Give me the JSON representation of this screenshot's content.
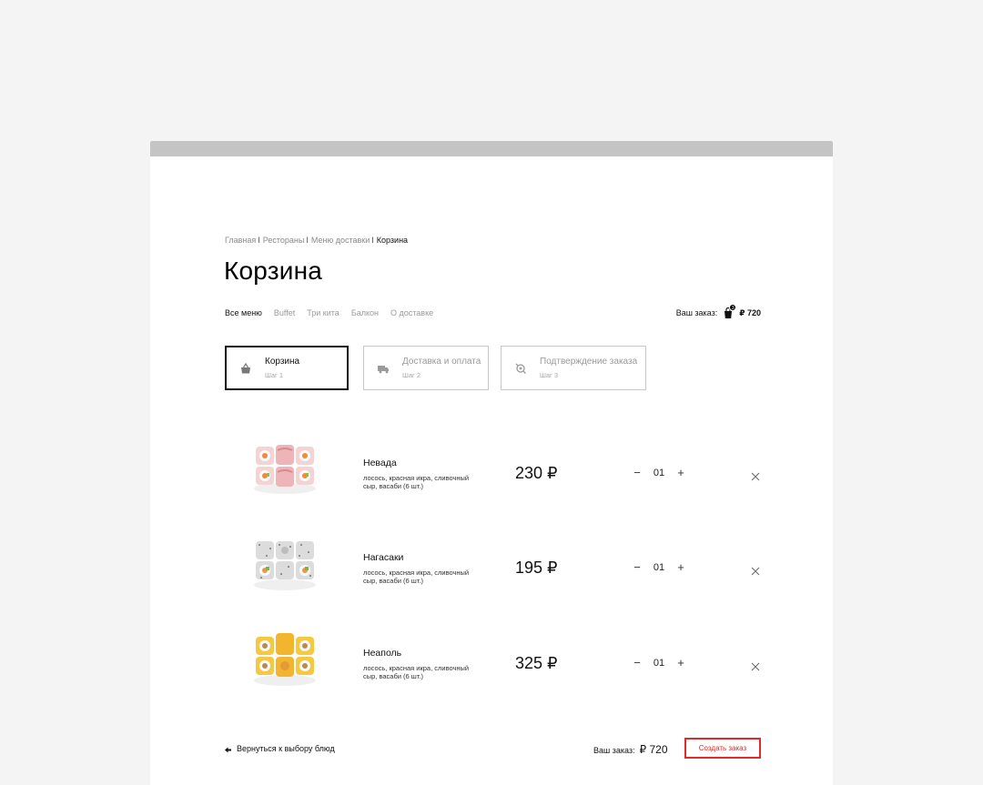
{
  "breadcrumb": {
    "items": [
      "Главная",
      "Рестораны",
      "Меню доставки",
      "Корзина"
    ],
    "separator": "I"
  },
  "page_title": "Корзина",
  "menu": {
    "items": [
      "Все меню",
      "Buffet",
      "Три кита",
      "Балкон",
      "О доставке"
    ],
    "active_index": 0
  },
  "order_summary": {
    "label": "Ваш заказ:",
    "badge_count": "3",
    "amount": "₽ 720",
    "icon": "shopping-bag-icon"
  },
  "steps": [
    {
      "label": "Корзина",
      "sub": "Шаг 1",
      "icon": "shopping-basket-icon",
      "active": true
    },
    {
      "label": "Доставка и оплата",
      "sub": "Шаг 2",
      "icon": "delivery-truck-icon",
      "active": false
    },
    {
      "label": "Подтверждение заказа",
      "sub": "Шаг 3",
      "icon": "confirmation-icon",
      "active": false
    }
  ],
  "cart_items": [
    {
      "name": "Невада",
      "description": "лосось, красная икра, сливочный сыр, васаби (6 шт.)",
      "price": "230 ₽",
      "quantity": "01",
      "image": "sushi-roll-nevada"
    },
    {
      "name": "Нагасаки",
      "description": "лосось, красная икра, сливочный сыр, васаби (6 шт.)",
      "price": "195 ₽",
      "quantity": "01",
      "image": "sushi-roll-nagasaki"
    },
    {
      "name": "Неаполь",
      "description": "лосось, красная икра, сливочный сыр, васаби (6 шт.)",
      "price": "325 ₽",
      "quantity": "01",
      "image": "sushi-roll-neapol"
    }
  ],
  "controls": {
    "minus": "−",
    "plus": "+"
  },
  "footer": {
    "back_label": "Вернуться к выбору блюд",
    "total_label": "Ваш заказ:",
    "total_amount": "₽ 720",
    "create_button": "Создать заказ"
  },
  "colors": {
    "accent": "#e12a2a",
    "text": "#111111",
    "muted": "#9a9a9a",
    "window_bar": "#c4c4c4",
    "background": "#f4f4f4"
  }
}
